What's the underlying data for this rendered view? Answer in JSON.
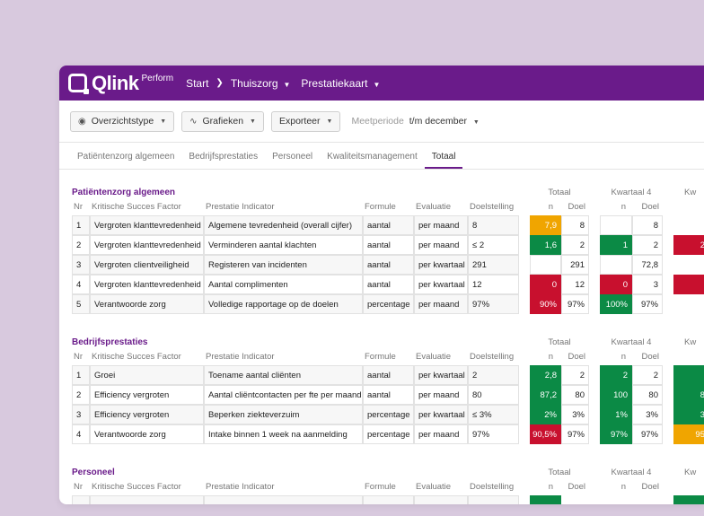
{
  "brand": {
    "name": "Qlink",
    "sup": "Perform"
  },
  "nav": {
    "start": "Start",
    "thuiszorg": "Thuiszorg",
    "prestatiekaart": "Prestatiekaart"
  },
  "toolbar": {
    "overzicht": "Overzichtstype",
    "grafieken": "Grafieken",
    "exporteer": "Exporteer",
    "period_label": "Meetperiode",
    "period_value": "t/m december"
  },
  "tabs": [
    "Patiëntenzorg algemeen",
    "Bedrijfsprestaties",
    "Personeel",
    "Kwaliteitsmanagement",
    "Totaal"
  ],
  "colors": {
    "header": "#6a1b8a",
    "green": "#0b8a45",
    "red": "#c8102e",
    "orange": "#f0a500"
  },
  "columns": {
    "nr": "Nr",
    "ksf": "Kritische Succes Factor",
    "pi": "Prestatie Indicator",
    "formule": "Formule",
    "evaluatie": "Evaluatie",
    "doel": "Doelstelling",
    "n": "n",
    "doel_short": "Doel"
  },
  "groups": {
    "totaal": "Totaal",
    "kwartaal4": "Kwartaal 4",
    "kw": "Kw"
  },
  "sections": [
    {
      "title": "Patiëntenzorg algemeen",
      "rows": [
        {
          "nr": "1",
          "ksf": "Vergroten klanttevredenheid",
          "pi": "Algemene tevredenheid (overall cijfer)",
          "formule": "aantal",
          "evaluatie": "per maand",
          "doel": "8",
          "t_n": "7,9",
          "t_s": "orange",
          "t_d": "8",
          "k_n": "",
          "k_s": "",
          "k_d": "8",
          "x_s": ""
        },
        {
          "nr": "2",
          "ksf": "Vergroten klanttevredenheid",
          "pi": "Verminderen aantal klachten",
          "formule": "aantal",
          "evaluatie": "per maand",
          "doel": "≤ 2",
          "t_n": "1,6",
          "t_s": "green",
          "t_d": "2",
          "k_n": "1",
          "k_s": "green",
          "k_d": "2",
          "x_s": "red",
          "x_n": "2"
        },
        {
          "nr": "3",
          "ksf": "Vergroten clientveiligheid",
          "pi": "Registeren van incidenten",
          "formule": "aantal",
          "evaluatie": "per kwartaal",
          "doel": "291",
          "t_n": "",
          "t_s": "",
          "t_d": "291",
          "k_n": "",
          "k_s": "",
          "k_d": "72,8",
          "x_s": ""
        },
        {
          "nr": "4",
          "ksf": "Vergroten klanttevredenheid",
          "pi": "Aantal complimenten",
          "formule": "aantal",
          "evaluatie": "per kwartaal",
          "doel": "12",
          "t_n": "0",
          "t_s": "red",
          "t_d": "12",
          "k_n": "0",
          "k_s": "red",
          "k_d": "3",
          "x_s": "red"
        },
        {
          "nr": "5",
          "ksf": "Verantwoorde zorg",
          "pi": "Volledige rapportage op de doelen",
          "formule": "percentage",
          "evaluatie": "per maand",
          "doel": "97%",
          "t_n": "90%",
          "t_s": "red",
          "t_d": "97%",
          "k_n": "100%",
          "k_s": "green",
          "k_d": "97%",
          "x_s": ""
        }
      ]
    },
    {
      "title": "Bedrijfsprestaties",
      "rows": [
        {
          "nr": "1",
          "ksf": "Groei",
          "pi": "Toename aantal cliënten",
          "formule": "aantal",
          "evaluatie": "per kwartaal",
          "doel": "2",
          "t_n": "2,8",
          "t_s": "green",
          "t_d": "2",
          "k_n": "2",
          "k_s": "green",
          "k_d": "2",
          "x_s": "green"
        },
        {
          "nr": "2",
          "ksf": "Efficiency vergroten",
          "pi": "Aantal cliëntcontacten per fte per maand",
          "formule": "aantal",
          "evaluatie": "per maand",
          "doel": "80",
          "t_n": "87,2",
          "t_s": "green",
          "t_d": "80",
          "k_n": "100",
          "k_s": "green",
          "k_d": "80",
          "x_s": "green",
          "x_n": "8"
        },
        {
          "nr": "3",
          "ksf": "Efficiency vergroten",
          "pi": "Beperken ziekteverzuim",
          "formule": "percentage",
          "evaluatie": "per kwartaal",
          "doel": "≤ 3%",
          "t_n": "2%",
          "t_s": "green",
          "t_d": "3%",
          "k_n": "1%",
          "k_s": "green",
          "k_d": "3%",
          "x_s": "green",
          "x_n": "3"
        },
        {
          "nr": "4",
          "ksf": "Verantwoorde zorg",
          "pi": "Intake binnen 1 week na aanmelding",
          "formule": "percentage",
          "evaluatie": "per maand",
          "doel": "97%",
          "t_n": "90,5%",
          "t_s": "red",
          "t_d": "97%",
          "k_n": "97%",
          "k_s": "green",
          "k_d": "97%",
          "x_s": "orange",
          "x_n": "95"
        }
      ]
    },
    {
      "title": "Personeel",
      "rows": []
    }
  ]
}
